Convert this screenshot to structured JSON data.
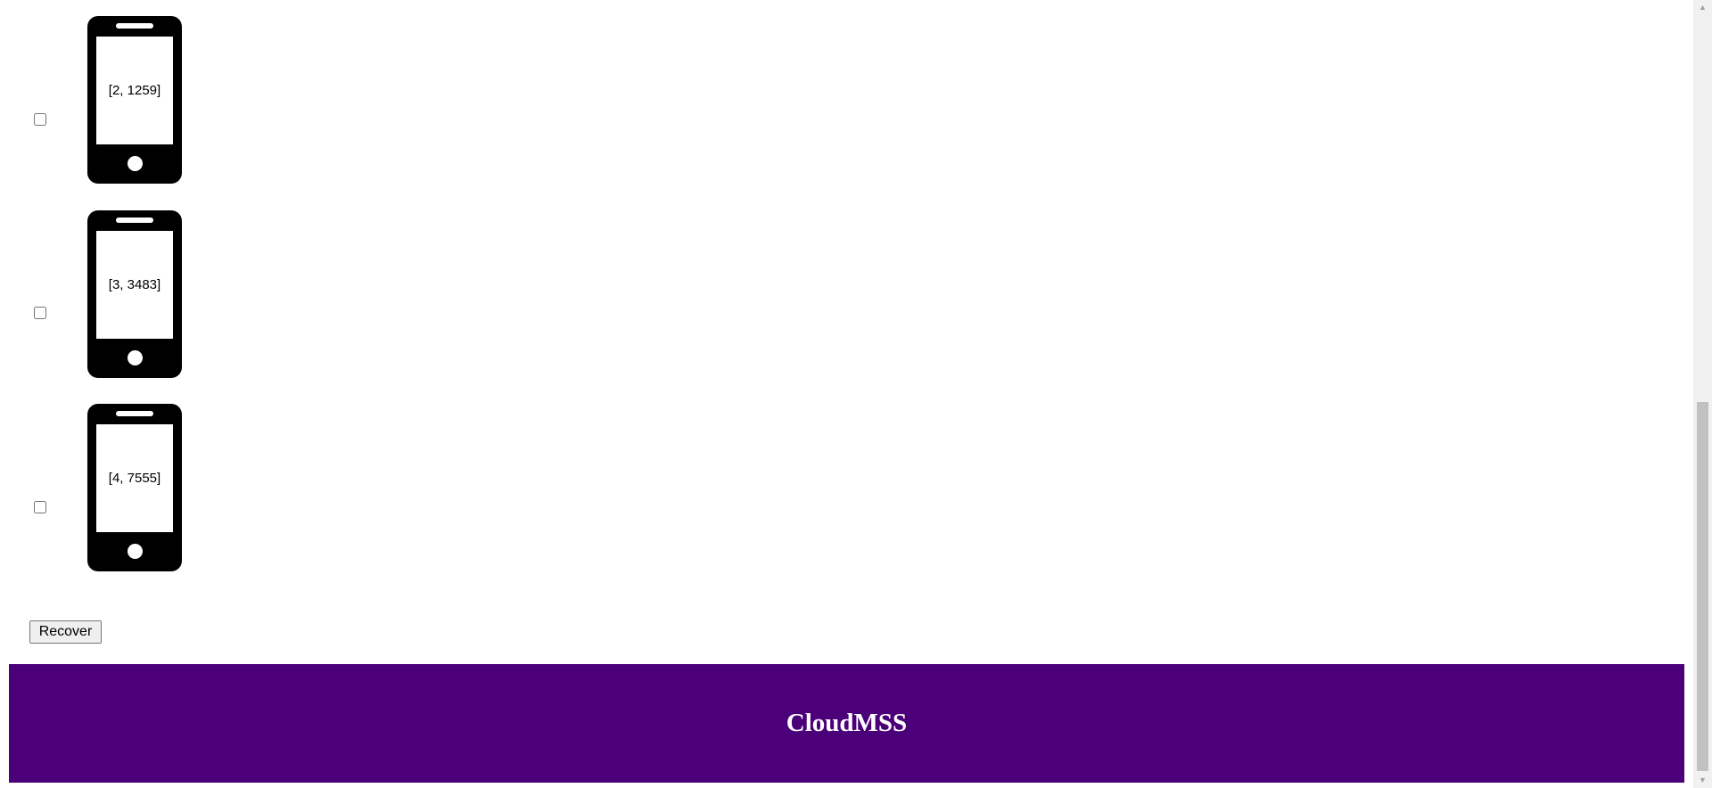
{
  "devices": [
    {
      "label": "[2, 1259]",
      "checked": false
    },
    {
      "label": "[3, 3483]",
      "checked": false
    },
    {
      "label": "[4, 7555]",
      "checked": false
    }
  ],
  "actions": {
    "recover_label": "Recover"
  },
  "footer": {
    "title": "CloudMSS",
    "background": "#4b0079"
  },
  "icons": {
    "device": "smartphone-icon",
    "scroll_up": "arrow-up-icon",
    "scroll_down": "arrow-down-icon"
  }
}
